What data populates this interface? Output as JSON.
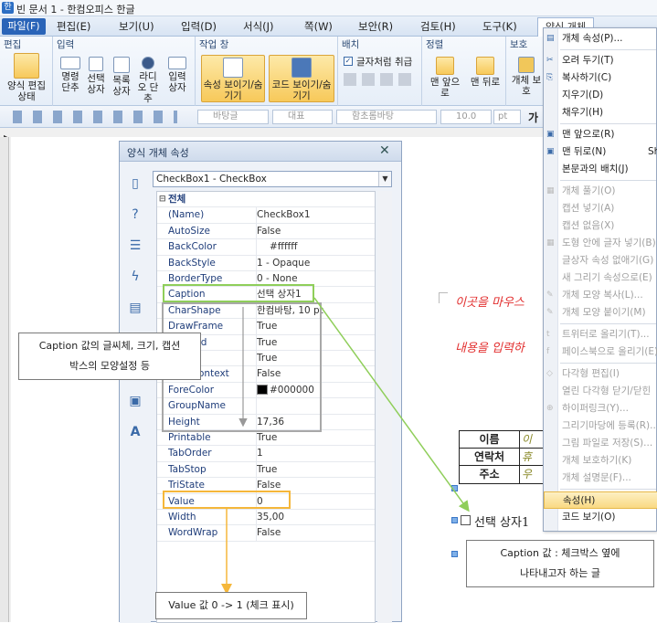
{
  "window": {
    "title": "빈 문서 1 - 한컴오피스 한글"
  },
  "menubar": {
    "items": [
      "파일(F)",
      "편집(E)",
      "보기(U)",
      "입력(D)",
      "서식(J)",
      "쪽(W)",
      "보안(R)",
      "검토(H)",
      "도구(K)",
      "양식 개체"
    ]
  },
  "ribbon": {
    "groups": [
      {
        "title": "편집",
        "buttons": [
          "양식 편집 상태"
        ]
      },
      {
        "title": "입력",
        "buttons": [
          "명령 단추",
          "선택 상자",
          "목록 상자",
          "라디오 단추",
          "입력 상자"
        ]
      },
      {
        "title": "작업 창",
        "buttons": [
          "속성 보이기/숨기기",
          "코드 보이기/숨기기"
        ]
      },
      {
        "title": "배치",
        "buttons": [
          "글자처럼 취급"
        ]
      },
      {
        "title": "정렬",
        "buttons": [
          "맨 앞으로",
          "맨 뒤로"
        ]
      },
      {
        "title": "보호",
        "buttons": [
          "개체 보호"
        ]
      }
    ]
  },
  "toolbar": {
    "style": "바탕글",
    "lang": "대표",
    "font": "함초롬바탕",
    "size": "10.0",
    "unit": "pt",
    "bold": "가"
  },
  "panel": {
    "title": "양식 개체 속성",
    "combo": "CheckBox1 - CheckBox",
    "section": "전체",
    "rows": [
      {
        "k": "(Name)",
        "v": "CheckBox1"
      },
      {
        "k": "AutoSize",
        "v": "False"
      },
      {
        "k": "BackColor",
        "v": "#ffffff"
      },
      {
        "k": "BackStyle",
        "v": "1 - Opaque"
      },
      {
        "k": "BorderType",
        "v": "0 - None"
      },
      {
        "k": "Caption",
        "v": "선택 상자1"
      },
      {
        "k": "CharShape",
        "v": "한컴바탕, 10 pt"
      },
      {
        "k": "DrawFrame",
        "v": "True"
      },
      {
        "k": "Enabled",
        "v": "True"
      },
      {
        "k": "Locked",
        "v": "True"
      },
      {
        "k": "MultiContext",
        "v": "False"
      },
      {
        "k": "ForeColor",
        "v": "#000000"
      },
      {
        "k": "GroupName",
        "v": ""
      },
      {
        "k": "Height",
        "v": "17,36"
      },
      {
        "k": "Printable",
        "v": "True"
      },
      {
        "k": "TabOrder",
        "v": "1"
      },
      {
        "k": "TabStop",
        "v": "True"
      },
      {
        "k": "TriState",
        "v": "False"
      },
      {
        "k": "Value",
        "v": "0"
      },
      {
        "k": "Width",
        "v": "35,00"
      },
      {
        "k": "WordWrap",
        "v": "False"
      }
    ]
  },
  "context_menu": {
    "items": [
      {
        "label": "개체 속성(P)...",
        "enabled": true
      },
      {
        "sep": true
      },
      {
        "label": "오려 두기(T)",
        "enabled": true
      },
      {
        "label": "복사하기(C)",
        "enabled": true
      },
      {
        "label": "지우기(D)",
        "enabled": true
      },
      {
        "label": "채우기(H)",
        "enabled": true
      },
      {
        "sep": true
      },
      {
        "label": "맨 앞으로(R)",
        "enabled": true
      },
      {
        "label": "맨 뒤로(N)",
        "enabled": true
      },
      {
        "label": "본문과의 배치(J)",
        "enabled": true
      },
      {
        "sep": true
      },
      {
        "label": "개체 풀기(O)",
        "enabled": false
      },
      {
        "label": "캡션 넣기(A)",
        "enabled": false
      },
      {
        "label": "캡션 없음(X)",
        "enabled": false
      },
      {
        "label": "도형 안에 글자 넣기(B)",
        "enabled": false
      },
      {
        "label": "글상자 속성 없애기(G)",
        "enabled": false
      },
      {
        "label": "새 그리기 속성으로(E)",
        "enabled": false
      },
      {
        "label": "개체 모양 복사(L)...",
        "enabled": false
      },
      {
        "label": "개체 모양 붙이기(M)",
        "enabled": false
      },
      {
        "sep": true
      },
      {
        "label": "트위터로 올리기(T)...",
        "enabled": false
      },
      {
        "label": "페이스북으로 올리기(E)",
        "enabled": false
      },
      {
        "sep": true
      },
      {
        "label": "다각형 편집(I)",
        "enabled": false
      },
      {
        "label": "열린 다각형 닫기/닫힌",
        "enabled": false
      },
      {
        "label": "하이퍼링크(Y)...",
        "enabled": false
      },
      {
        "label": "그리기마당에 등록(R)...",
        "enabled": false
      },
      {
        "label": "그림 파일로 저장(S)...",
        "enabled": false
      },
      {
        "label": "개체 보호하기(K)",
        "enabled": false
      },
      {
        "label": "개체 설명문(F)...",
        "enabled": false
      },
      {
        "sep": true
      },
      {
        "label": "속성(H)",
        "enabled": true,
        "highlight": true
      },
      {
        "label": "코드 보기(O)",
        "enabled": true
      }
    ],
    "shortcut_fragment": "Sh"
  },
  "annotations": {
    "caption_style": {
      "line1": "Caption 값의 글씨체, 크기, 캡션",
      "line2": "박스의 모양설정 등"
    },
    "caption_value": {
      "line1": "Caption 값 : 체크박스 옆에",
      "line2": "나타내고자 하는 글"
    },
    "value_note": "Value 값  0 -> 1  (체크 표시)"
  },
  "document": {
    "red_line1": "이곳을 마우스",
    "red_line2": "내용을 입력하",
    "table": [
      {
        "label": "이름",
        "value": "이"
      },
      {
        "label": "연락처",
        "value": "휴"
      },
      {
        "label": "주소",
        "value": "우"
      }
    ],
    "checkbox_label": "선택 상자1"
  },
  "colors": {
    "green_highlight": "#8fce5a",
    "orange_highlight": "#f5b73a",
    "menu_highlight": "#f9d982",
    "red_text": "#e23030"
  }
}
